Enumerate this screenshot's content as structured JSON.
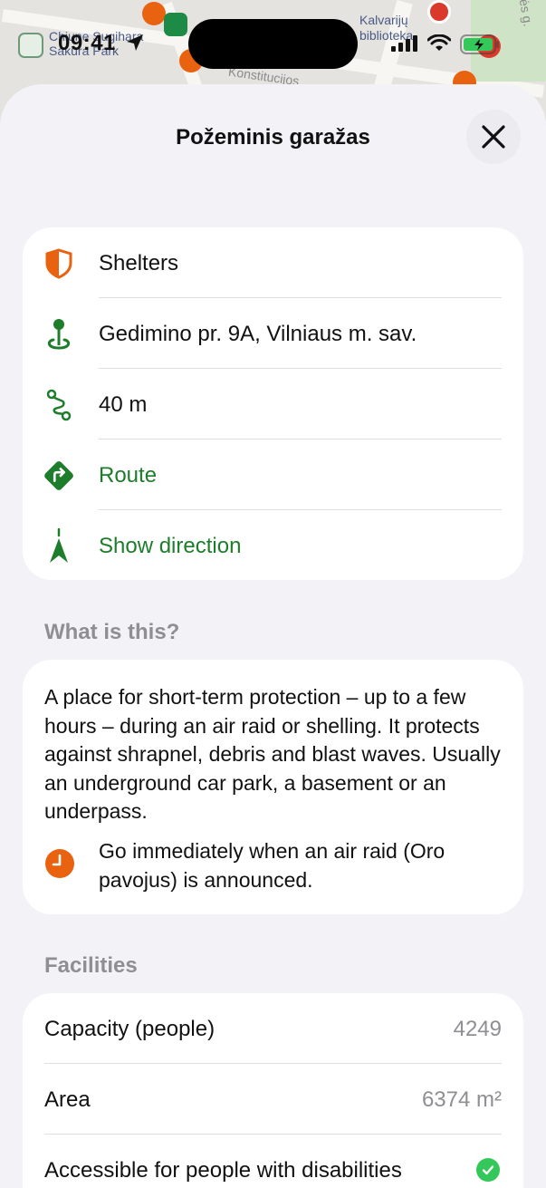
{
  "map": {
    "labels": [
      "Chiune Sugihara",
      "Sakura Park",
      "Kalvarijų",
      "biblioteka",
      "Konstitucijos",
      "ės g."
    ]
  },
  "status_bar": {
    "time": "09:41"
  },
  "sheet": {
    "title": "Požeminis garažas"
  },
  "info": {
    "category": "Shelters",
    "address": "Gedimino pr. 9A, Vilniaus m. sav.",
    "distance": "40 m",
    "route_label": "Route",
    "direction_label": "Show direction"
  },
  "what_is_this": {
    "title": "What is this?",
    "description": "A place for short-term protection – up to a few hours – during an air raid or shelling. It protects against shrapnel, debris and blast waves. Usually an underground car park, a basement or an underpass.",
    "note": "Go immediately when an air raid (Oro pavojus) is announced."
  },
  "facilities": {
    "title": "Facilities",
    "capacity_label": "Capacity (people)",
    "capacity_value": "4249",
    "area_label": "Area",
    "area_value": "6374 m²",
    "accessible_label": "Accessible for people with disabilities"
  },
  "colors": {
    "accent_green": "#1d7d2a",
    "accent_orange": "#e8620f",
    "check_green": "#34c759"
  }
}
